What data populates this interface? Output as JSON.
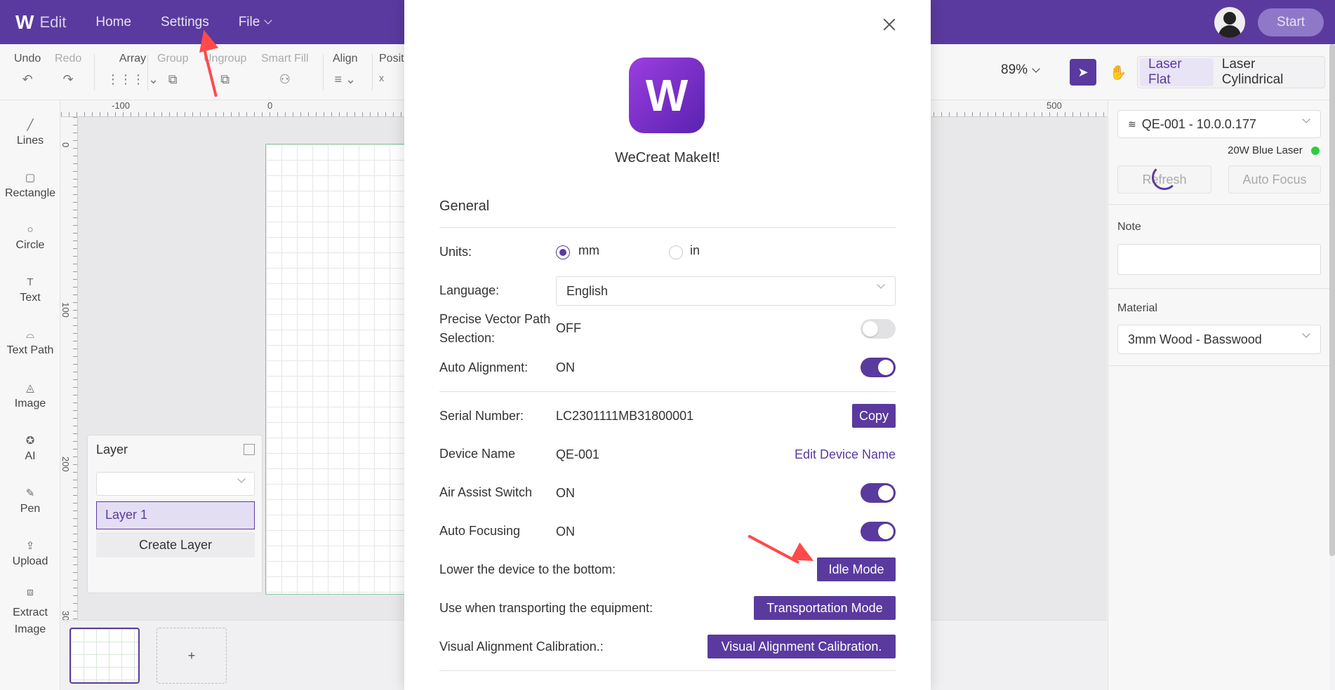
{
  "topbar": {
    "logo": "W",
    "edit_label": "Edit",
    "nav": [
      "Home",
      "Settings",
      "File"
    ],
    "start_label": "Start"
  },
  "toolbar": {
    "undo": "Undo",
    "redo": "Redo",
    "array": "Array",
    "group": "Group",
    "ungroup": "Ungroup",
    "smart_fill": "Smart Fill",
    "align": "Align",
    "position": "Posit",
    "position_x": "x",
    "zoom": "89%",
    "laser_flat": "Laser Flat",
    "laser_cylindrical": "Laser Cylindrical"
  },
  "sidebar": {
    "items": [
      "Lines",
      "Rectangle",
      "Circle",
      "Text",
      "Text Path",
      "Image",
      "AI",
      "Pen",
      "Upload",
      "Extract Image"
    ]
  },
  "ruler": {
    "top": [
      "-100",
      "0",
      "500"
    ],
    "left": [
      "0",
      "100",
      "200",
      "30"
    ]
  },
  "layer_panel": {
    "title": "Layer",
    "selected_layer": "Layer 1",
    "create_label": "Create Layer"
  },
  "bottom": {
    "add_label": "+"
  },
  "right_panel": {
    "device": "QE-001 - 10.0.0.177",
    "laser_type": "20W Blue Laser",
    "refresh": "Refresh",
    "auto_focus": "Auto Focus",
    "note_label": "Note",
    "material_label": "Material",
    "material_value": "3mm Wood - Basswood"
  },
  "modal": {
    "app_name": "WeCreat MakeIt!",
    "section_title": "General",
    "units_label": "Units:",
    "units_mm": "mm",
    "units_in": "in",
    "language_label": "Language:",
    "language_value": "English",
    "precise_label": "Precise Vector Path Selection:",
    "precise_value": "OFF",
    "auto_align_label": "Auto Alignment:",
    "auto_align_value": "ON",
    "serial_label": "Serial Number:",
    "serial_value": "LC2301111MB31800001",
    "copy_label": "Copy",
    "device_name_label": "Device Name",
    "device_name_value": "QE-001",
    "edit_device_name": "Edit Device Name",
    "air_assist_label": "Air Assist Switch",
    "air_assist_value": "ON",
    "auto_focusing_label": "Auto Focusing",
    "auto_focusing_value": "ON",
    "lower_label": "Lower the device to the bottom:",
    "idle_mode": "Idle Mode",
    "transport_label": "Use when transporting the equipment:",
    "transport_mode": "Transportation Mode",
    "visual_label": "Visual Alignment Calibration.:",
    "visual_button": "Visual Alignment Calibration."
  }
}
